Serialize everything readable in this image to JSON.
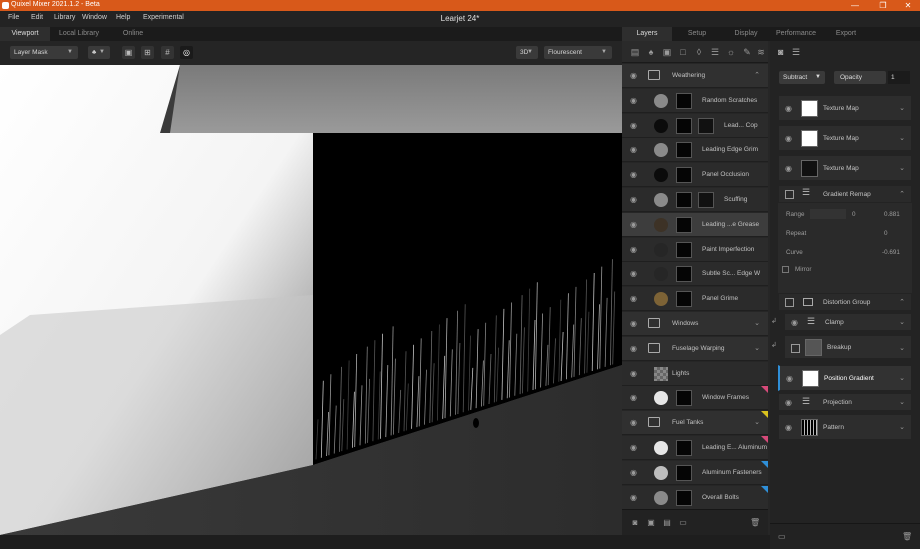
{
  "window": {
    "title": "Quixel Mixer 2021.1.2 - Beta",
    "controls": [
      "—",
      "❐",
      "✕"
    ]
  },
  "menu": [
    "File",
    "Edit",
    "Library",
    "Window",
    "Help",
    "Experimental"
  ],
  "document_title": "Learjet 24*",
  "left_tabs": [
    "Viewport",
    "Local Library",
    "Online"
  ],
  "viewport_toolbar": {
    "channel": "Layer Mask",
    "view_mode": "3D",
    "lighting": "Flourescent"
  },
  "right_tabs": [
    "Layers",
    "Setup",
    "Display",
    "Performance",
    "Export"
  ],
  "layers": [
    {
      "name": "Weathering",
      "type": "group",
      "expanded": true
    },
    {
      "name": "Random Scratches",
      "type": "layer",
      "color": "#8a8a8a"
    },
    {
      "name": "Lead... Cop",
      "type": "layer",
      "color": "#0b0b0b"
    },
    {
      "name": "Leading Edge Grim",
      "type": "layer",
      "color": "#8a8a8a"
    },
    {
      "name": "Panel Occlusion",
      "type": "layer",
      "color": "#0b0b0b"
    },
    {
      "name": "Scuffing",
      "type": "layer",
      "color": "#8a8a8a"
    },
    {
      "name": "Leading ...e Grease",
      "type": "layer",
      "color": "#3d3226",
      "selected": true
    },
    {
      "name": "Paint Imperfection",
      "type": "layer",
      "color": "#262626"
    },
    {
      "name": "Subtle Sc... Edge W",
      "type": "layer",
      "color": "#262626"
    },
    {
      "name": "Panel Grime",
      "type": "layer",
      "color": "#7d6336"
    },
    {
      "name": "Windows",
      "type": "group"
    },
    {
      "name": "Fuselage Warping",
      "type": "group"
    },
    {
      "name": "Lights",
      "type": "layer"
    },
    {
      "name": "Window Frames",
      "type": "layer",
      "color": "#e6e6e6",
      "tag": "#d64a7a"
    },
    {
      "name": "Fuel Tanks",
      "type": "group",
      "tag": "#d9c21e"
    },
    {
      "name": "Leading E... Aluminum",
      "type": "layer",
      "color": "#e6e6e6",
      "tag": "#d64a7a"
    },
    {
      "name": "Aluminum Fasteners",
      "type": "layer",
      "color": "#bdbdbd",
      "tag": "#2f8fd8"
    },
    {
      "name": "Overall Bolts",
      "type": "layer",
      "color": "#8a8a8a",
      "tag": "#2f8fd8"
    }
  ],
  "properties": {
    "blend_mode": "Subtract",
    "opacity_label": "Opacity",
    "opacity_value": "1",
    "texture_maps": [
      "Texture Map",
      "Texture Map",
      "Texture Map"
    ],
    "gradient_remap": {
      "title": "Gradient Remap",
      "range_label": "Range",
      "range_min": "0",
      "range_max": "0.881",
      "repeat_label": "Repeat",
      "repeat_value": "0",
      "curve_label": "Curve",
      "curve_value": "-0.691",
      "mirror_label": "Mirror"
    },
    "distortion_group": "Distortion Group",
    "clamp": "Clamp",
    "breakup": "Breakup",
    "position_gradient": "Position Gradient",
    "projection": "Projection",
    "pattern": "Pattern"
  }
}
